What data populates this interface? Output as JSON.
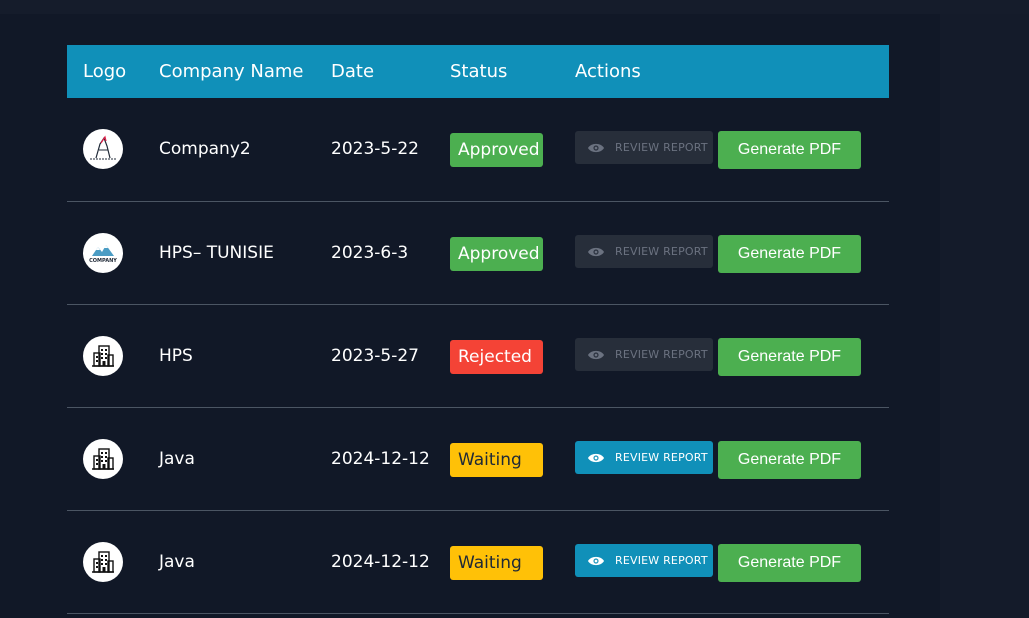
{
  "colors": {
    "header": "#1090b9",
    "approved": "#4caf50",
    "rejected": "#f44336",
    "waiting": "#ffc107",
    "pdf_button": "#4caf50",
    "background": "#111827"
  },
  "table": {
    "headers": {
      "logo": "Logo",
      "company_name": "Company Name",
      "date": "Date",
      "status": "Status",
      "actions": "Actions"
    },
    "rows": [
      {
        "logo_icon": "company2-logo",
        "name": "Company2",
        "date": "2023-5-22",
        "status": "Approved",
        "status_type": "approved",
        "review_label": "REVIEW REPORT",
        "review_enabled": false,
        "pdf_label": "Generate PDF"
      },
      {
        "logo_icon": "company-mountain-logo",
        "logo_text": "COMPANY",
        "name": "HPS– TUNISIE",
        "date": "2023-6-3",
        "status": "Approved",
        "status_type": "approved",
        "review_label": "REVIEW REPORT",
        "review_enabled": false,
        "pdf_label": "Generate PDF"
      },
      {
        "logo_icon": "building-icon",
        "name": "HPS",
        "date": "2023-5-27",
        "status": "Rejected",
        "status_type": "rejected",
        "review_label": "REVIEW REPORT",
        "review_enabled": false,
        "pdf_label": "Generate PDF"
      },
      {
        "logo_icon": "building-icon",
        "name": "Java",
        "date": "2024-12-12",
        "status": "Waiting",
        "status_type": "waiting",
        "review_label": "REVIEW REPORT",
        "review_enabled": true,
        "pdf_label": "Generate PDF"
      },
      {
        "logo_icon": "building-icon",
        "name": "Java",
        "date": "2024-12-12",
        "status": "Waiting",
        "status_type": "waiting",
        "review_label": "REVIEW REPORT",
        "review_enabled": true,
        "pdf_label": "Generate PDF"
      }
    ]
  }
}
